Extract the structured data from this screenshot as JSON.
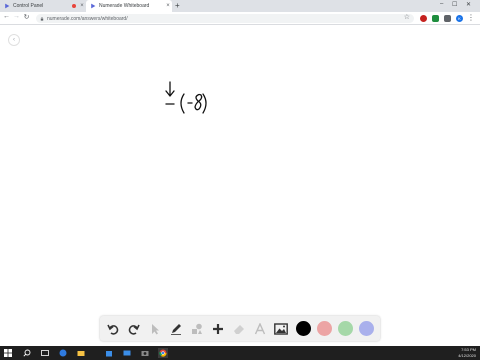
{
  "browser": {
    "tabs": [
      {
        "label": "Control Panel",
        "active": false,
        "favicon": "numerade-play-icon"
      },
      {
        "label": "Numerade Whiteboard",
        "active": true,
        "favicon": "numerade-play-icon"
      }
    ],
    "url": "numerade.com/answers/whiteboard/",
    "extensions": [
      "record-extension-icon",
      "green-extension-icon",
      "profile-icon"
    ]
  },
  "whiteboard": {
    "handwriting": {
      "expression": "-(-8)",
      "annotation": "arrow pointing down at minus sign"
    },
    "tools": [
      "undo-icon",
      "redo-icon",
      "pointer-icon",
      "pen-icon",
      "shapes-icon",
      "add-icon",
      "eraser-icon",
      "text-icon",
      "image-icon"
    ],
    "colors": [
      {
        "name": "black",
        "hex": "#000000",
        "selected": true
      },
      {
        "name": "red",
        "hex": "#eca4a4"
      },
      {
        "name": "green",
        "hex": "#a5d8a8"
      },
      {
        "name": "blue",
        "hex": "#a9b0ec"
      }
    ]
  },
  "taskbar": {
    "time": "7:53 PM",
    "date": "4/12/2020"
  },
  "colors": {
    "accent": "#4285f4",
    "tab_strip": "#dee1e6",
    "taskbar": "#1f1f1f"
  }
}
